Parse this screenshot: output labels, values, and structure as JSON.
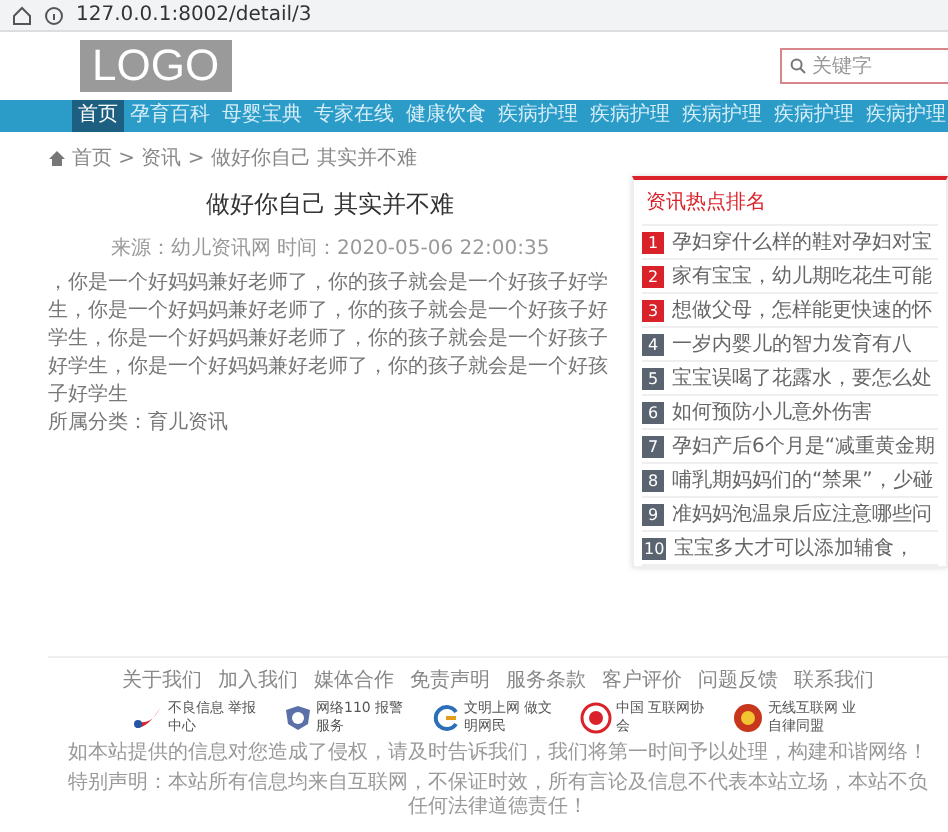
{
  "address_bar": {
    "url": "127.0.0.1:8002/detail/3"
  },
  "header": {
    "logo": "LOGO",
    "search": {
      "placeholder": "关键字"
    }
  },
  "nav": [
    {
      "label": "首页",
      "selected": true
    },
    {
      "label": "孕育百科",
      "selected": false
    },
    {
      "label": "母婴宝典",
      "selected": false
    },
    {
      "label": "专家在线",
      "selected": false
    },
    {
      "label": "健康饮食",
      "selected": false
    },
    {
      "label": "疾病护理",
      "selected": false
    },
    {
      "label": "疾病护理",
      "selected": false
    },
    {
      "label": "疾病护理",
      "selected": false
    },
    {
      "label": "疾病护理",
      "selected": false
    },
    {
      "label": "疾病护理",
      "selected": false
    }
  ],
  "breadcrumb": "首页 > 资讯 > 做好你自己 其实并不难",
  "article": {
    "title": "做好你自己 其实并不难",
    "meta": "来源：幼儿资讯网 时间：2020-05-06 22:00:35",
    "body": "，你是一个好妈妈兼好老师了，你的孩子就会是一个好孩子好学生，你是一个好妈妈兼好老师了，你的孩子就会是一个好孩子好学生，你是一个好妈妈兼好老师了，你的孩子就会是一个好孩子好学生，你是一个好妈妈兼好老师了，你的孩子就会是一个好孩子好学生",
    "category": "所属分类：育儿资讯"
  },
  "sidebar": {
    "title": "资讯热点排名",
    "items": [
      {
        "rank": "1",
        "text": "孕妇穿什么样的鞋对孕妇对宝",
        "color": "#d9222a"
      },
      {
        "rank": "2",
        "text": "家有宝宝，幼儿期吃花生可能",
        "color": "#d9222a"
      },
      {
        "rank": "3",
        "text": "想做父母，怎样能更快速的怀",
        "color": "#d9222a"
      },
      {
        "rank": "4",
        "text": "一岁内婴儿的智力发育有八",
        "color": "#5a6470"
      },
      {
        "rank": "5",
        "text": "宝宝误喝了花露水，要怎么处",
        "color": "#5a6470"
      },
      {
        "rank": "6",
        "text": "如何预防小儿意外伤害",
        "color": "#5a6470"
      },
      {
        "rank": "7",
        "text": "孕妇产后6个月是“减重黄金期",
        "color": "#5a6470"
      },
      {
        "rank": "8",
        "text": "哺乳期妈妈们的“禁果”，少碰",
        "color": "#5a6470"
      },
      {
        "rank": "9",
        "text": "准妈妈泡温泉后应注意哪些问",
        "color": "#5a6470"
      },
      {
        "rank": "10",
        "text": "宝宝多大才可以添加辅食，",
        "color": "#5a6470"
      }
    ]
  },
  "footer": {
    "links": [
      "关于我们",
      "加入我们",
      "媒体合作",
      "免责声明",
      "服务条款",
      "客户评价",
      "问题反馈",
      "联系我们"
    ],
    "badges": [
      {
        "kind": "swoosh",
        "text": "不良信息 举报中心"
      },
      {
        "kind": "shield",
        "text": "网络110 报警服务"
      },
      {
        "kind": "ring",
        "text": "文明上网 做文明网民"
      },
      {
        "kind": "seal",
        "text": "中国 互联网协会"
      },
      {
        "kind": "emblem",
        "text": "无线互联网 业自律同盟"
      }
    ],
    "notices": [
      "如本站提供的信息对您造成了侵权，请及时告诉我们，我们将第一时间予以处理，构建和谐网络！",
      "特别声明：本站所有信息均来自互联网，不保证时效，所有言论及信息不代表本站立场，本站不负任何法律道德责任！"
    ]
  }
}
